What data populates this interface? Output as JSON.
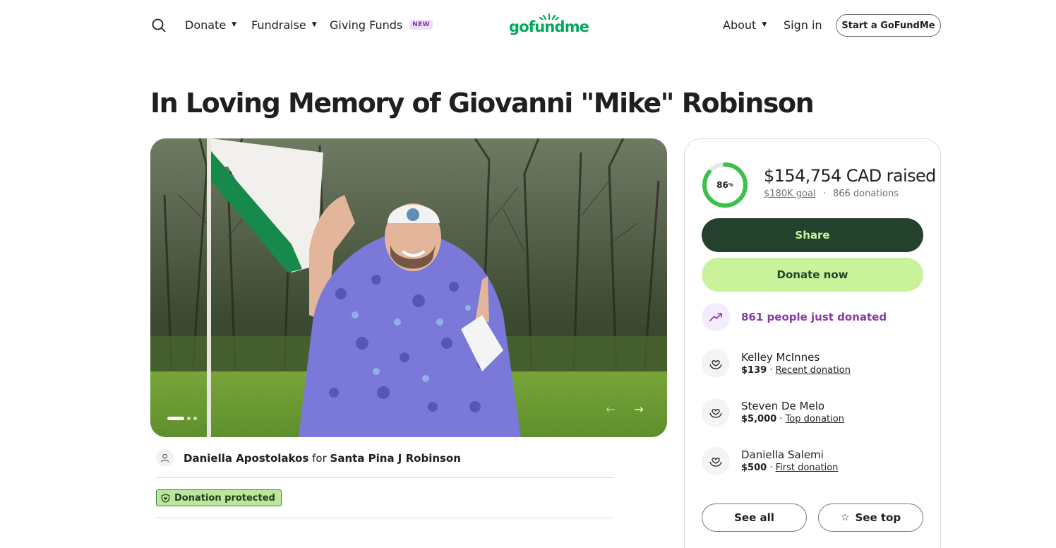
{
  "header": {
    "nav": [
      {
        "label": "Donate",
        "has_caret": true
      },
      {
        "label": "Fundraise",
        "has_caret": true
      },
      {
        "label": "Giving Funds",
        "badge": "NEW"
      }
    ],
    "logo": "gofundme",
    "about_label": "About",
    "signin_label": "Sign in",
    "start_label": "Start a GoFundMe"
  },
  "campaign": {
    "title": "In Loving Memory of Giovanni \"Mike\" Robinson",
    "organizer": "Daniella Apostolakos",
    "for_word": "for",
    "beneficiary": "Santa Pina J Robinson",
    "protected_label": "Donation protected",
    "carousel": {
      "count": 3,
      "active": 0
    }
  },
  "donation": {
    "progress_percent": 86,
    "progress_label": "86",
    "progress_unit": "%",
    "raised": "$154,754 CAD raised",
    "goal": "$180K goal",
    "separator": "·",
    "donations_count": "866 donations",
    "share_label": "Share",
    "donate_label": "Donate now",
    "trend_text": "861 people just donated",
    "donors": [
      {
        "name": "Kelley McInnes",
        "amount": "$139",
        "tag": "Recent donation"
      },
      {
        "name": "Steven De Melo",
        "amount": "$5,000",
        "tag": "Top donation"
      },
      {
        "name": "Daniella Salemi",
        "amount": "$500",
        "tag": "First donation"
      }
    ],
    "see_all_label": "See all",
    "see_top_label": "See top"
  },
  "colors": {
    "brand_green": "#02a95c",
    "share_bg": "#24412d",
    "donate_bg": "#c9f29b",
    "trend_purple": "#8a3aaa",
    "progress_green": "#3bc14a"
  }
}
